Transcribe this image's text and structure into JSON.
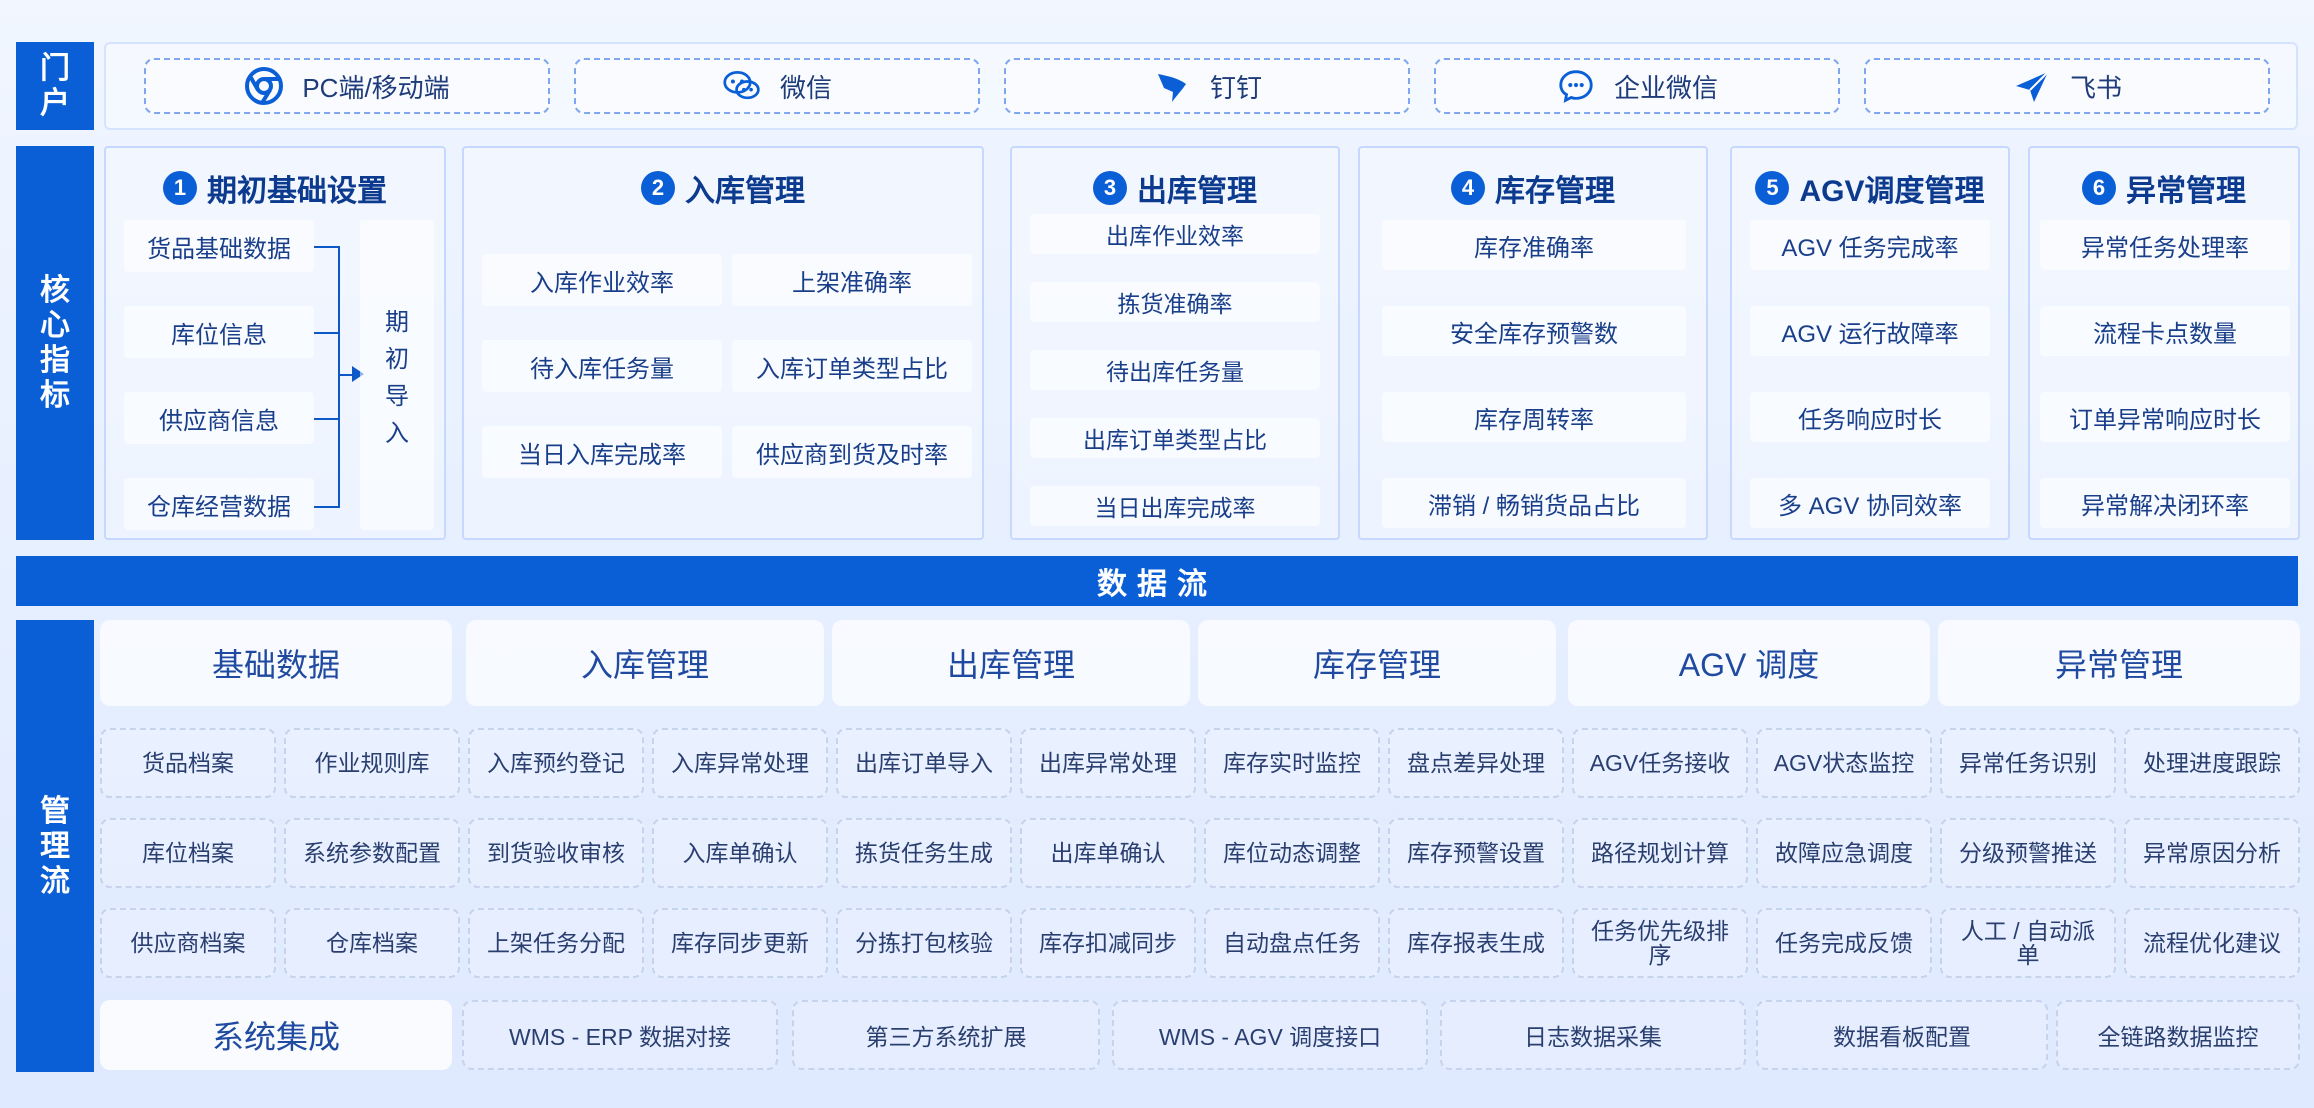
{
  "sidebar": {
    "portal": [
      "门",
      "户"
    ],
    "core": [
      "核",
      "心",
      "指",
      "标"
    ],
    "mgmt": [
      "管",
      "理",
      "流"
    ]
  },
  "portal": {
    "items": [
      {
        "label": "PC端/移动端",
        "icon": "chrome-icon"
      },
      {
        "label": "微信",
        "icon": "wechat-icon"
      },
      {
        "label": "钉钉",
        "icon": "dingtalk-icon"
      },
      {
        "label": "企业微信",
        "icon": "wecom-icon"
      },
      {
        "label": "飞书",
        "icon": "feishu-icon"
      }
    ]
  },
  "core": {
    "panels": [
      {
        "num": "1",
        "title": "期初基础设置",
        "items": [
          "货品基础数据",
          "库位信息",
          "供应商信息",
          "仓库经营数据"
        ],
        "side_label": [
          "期",
          "初",
          "导",
          "入"
        ]
      },
      {
        "num": "2",
        "title": "入库管理",
        "items": [
          "入库作业效率",
          "上架准确率",
          "待入库任务量",
          "入库订单类型占比",
          "当日入库完成率",
          "供应商到货及时率"
        ]
      },
      {
        "num": "3",
        "title": "出库管理",
        "items": [
          "出库作业效率",
          "拣货准确率",
          "待出库任务量",
          "出库订单类型占比",
          "当日出库完成率"
        ]
      },
      {
        "num": "4",
        "title": "库存管理",
        "items": [
          "库存准确率",
          "安全库存预警数",
          "库存周转率",
          "滞销 / 畅销货品占比"
        ]
      },
      {
        "num": "5",
        "title": "AGV调度管理",
        "items": [
          "AGV 任务完成率",
          "AGV 运行故障率",
          "任务响应时长",
          "多 AGV 协同效率"
        ]
      },
      {
        "num": "6",
        "title": "异常管理",
        "items": [
          "异常任务处理率",
          "流程卡点数量",
          "订单异常响应时长",
          "异常解决闭环率"
        ]
      }
    ]
  },
  "flowbar": {
    "label": "数据流"
  },
  "mgmt": {
    "heads": [
      "基础数据",
      "入库管理",
      "出库管理",
      "库存管理",
      "AGV 调度",
      "异常管理"
    ],
    "rows": [
      [
        "货品档案",
        "作业规则库",
        "入库预约登记",
        "入库异常处理",
        "出库订单导入",
        "出库异常处理",
        "库存实时监控",
        "盘点差异处理",
        "AGV任务接收",
        "AGV状态监控",
        "异常任务识别",
        "处理进度跟踪"
      ],
      [
        "库位档案",
        "系统参数配置",
        "到货验收审核",
        "入库单确认",
        "拣货任务生成",
        "出库单确认",
        "库位动态调整",
        "库存预警设置",
        "路径规划计算",
        "故障应急调度",
        "分级预警推送",
        "异常原因分析"
      ],
      [
        "供应商档案",
        "仓库档案",
        "上架任务分配",
        "库存同步更新",
        "分拣打包核验",
        "库存扣减同步",
        "自动盘点任务",
        "库存报表生成",
        "任务优先级排序",
        "任务完成反馈",
        "人工 / 自动派单",
        "流程优化建议"
      ]
    ],
    "integration": {
      "label": "系统集成",
      "items": [
        "WMS - ERP 数据对接",
        "第三方系统扩展",
        "WMS - AGV 调度接口",
        "日志数据采集",
        "数据看板配置",
        "全链路数据监控"
      ]
    }
  }
}
